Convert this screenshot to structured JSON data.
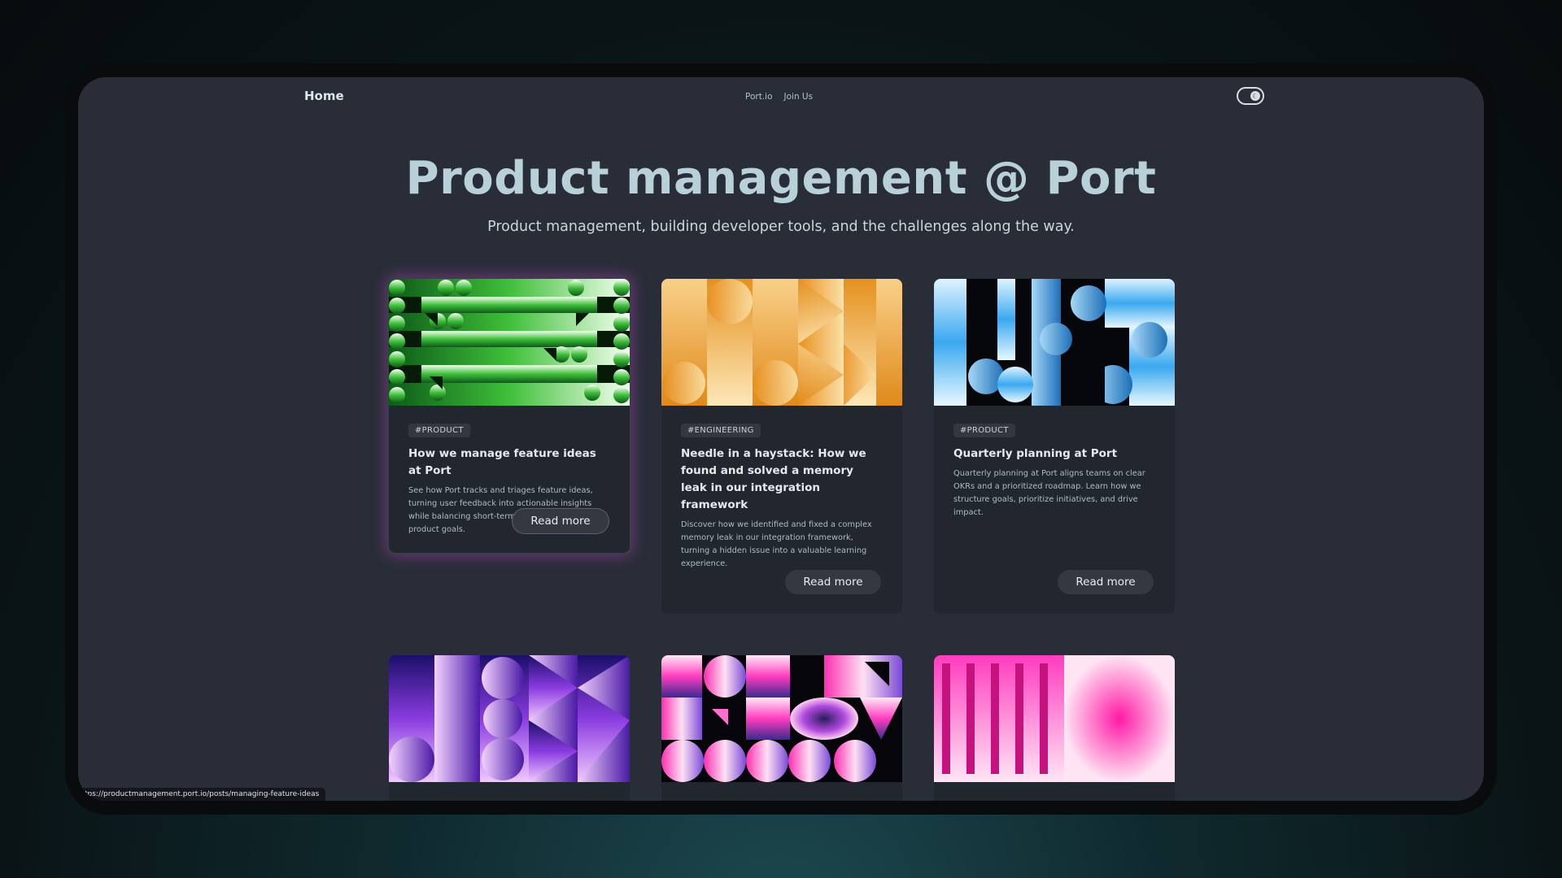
{
  "nav": {
    "home_label": "Home",
    "links": [
      "Port.io",
      "Join Us"
    ]
  },
  "hero": {
    "title": "Product management @ Port",
    "subtitle": "Product management, building developer tools, and the challenges along the way."
  },
  "posts": [
    {
      "tag": "#PRODUCT",
      "title": "How we manage feature ideas at Port",
      "description": "See how Port tracks and triages feature ideas, turning user feedback into actionable insights while balancing short-term needs with long-term product goals.",
      "button": "Read more",
      "image_theme": "green"
    },
    {
      "tag": "#ENGINEERING",
      "title": "Needle in a haystack: How we found and solved a memory leak in our integration framework",
      "description": "Discover how we identified and fixed a complex memory leak in our integration framework, turning a hidden issue into a valuable learning experience.",
      "button": "Read more",
      "image_theme": "orange"
    },
    {
      "tag": "#PRODUCT",
      "title": "Quarterly planning at Port",
      "description": "Quarterly planning at Port aligns teams on clear OKRs and a prioritized roadmap. Learn how we structure goals, prioritize initiatives, and drive impact.",
      "button": "Read more",
      "image_theme": "blue"
    }
  ],
  "more_posts": [
    {
      "image_theme": "purple"
    },
    {
      "image_theme": "pink-black"
    },
    {
      "image_theme": "magenta"
    }
  ],
  "status_bar": {
    "url": "tps://productmanagement.port.io/posts/managing-feature-ideas"
  },
  "colors": {
    "screen_bg": "#282d37",
    "card_bg": "#22272f",
    "title": "#b8d0d8",
    "active_glow": "#be46c8"
  }
}
